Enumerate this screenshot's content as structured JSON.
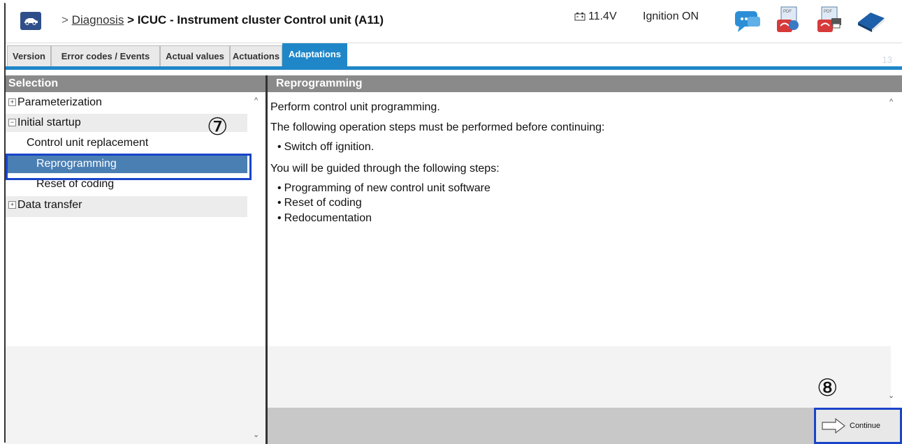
{
  "header": {
    "breadcrumb_sep": ">",
    "breadcrumb_link": "Diagnosis",
    "breadcrumb_current": "> ICUC - Instrument cluster Control unit (A11)",
    "voltage": "11.4V",
    "ignition": "Ignition ON",
    "icons": [
      "chat-icon",
      "pdf-print-icon",
      "pdf-save-icon",
      "manual-book-icon"
    ]
  },
  "tabs": [
    {
      "label": "Version"
    },
    {
      "label": "Error codes / Events"
    },
    {
      "label": "Actual values"
    },
    {
      "label": "Actuations"
    },
    {
      "label": "Adaptations",
      "active": true
    }
  ],
  "faint_label": "13",
  "left_pane": {
    "title": "Selection",
    "items": [
      {
        "label": "Parameterization",
        "toggle": "+"
      },
      {
        "label": "Initial startup",
        "toggle": "−"
      },
      {
        "label": "Control unit replacement"
      },
      {
        "label": "Reprogramming",
        "selected": true
      },
      {
        "label": "Reset of coding"
      },
      {
        "label": "Data transfer",
        "toggle": "+"
      }
    ]
  },
  "right_pane": {
    "title": "Reprogramming",
    "intro": "Perform control unit programming.",
    "pre_steps_heading": "The following operation steps must be performed before continuing:",
    "pre_steps": [
      "Switch off ignition."
    ],
    "guided_heading": "You will be guided through the following steps:",
    "guided_steps": [
      "Programming of new control unit software",
      "Reset of coding",
      "Redocumentation"
    ]
  },
  "annotations": {
    "left": "⑦",
    "right": "⑧"
  },
  "continue_label": "Continue",
  "colors": {
    "accent": "#1f86c8",
    "selection": "#4a7fb3",
    "highlight_box": "#1a44c9"
  }
}
